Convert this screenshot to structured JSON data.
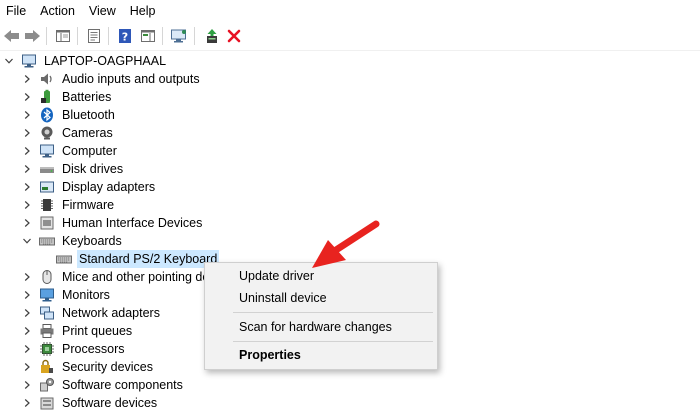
{
  "menu": {
    "file": "File",
    "action": "Action",
    "view": "View",
    "help": "Help"
  },
  "toolbar": {
    "buttons": [
      "back-icon",
      "forward-icon",
      "show-hide-console-tree-icon",
      "properties-icon",
      "help-icon",
      "action-pane-icon",
      "scan-hardware-icon",
      "update-driver-icon",
      "uninstall-icon"
    ]
  },
  "tree": {
    "root": "LAPTOP-OAGPHAAL",
    "categories": [
      {
        "label": "Audio inputs and outputs",
        "icon": "speaker-icon"
      },
      {
        "label": "Batteries",
        "icon": "battery-icon"
      },
      {
        "label": "Bluetooth",
        "icon": "bluetooth-icon"
      },
      {
        "label": "Cameras",
        "icon": "camera-icon"
      },
      {
        "label": "Computer",
        "icon": "computer-icon"
      },
      {
        "label": "Disk drives",
        "icon": "disk-drive-icon"
      },
      {
        "label": "Display adapters",
        "icon": "display-adapter-icon"
      },
      {
        "label": "Firmware",
        "icon": "firmware-icon"
      },
      {
        "label": "Human Interface Devices",
        "icon": "hid-icon"
      },
      {
        "label": "Keyboards",
        "icon": "keyboard-icon"
      },
      {
        "label": "Standard PS/2 Keyboard",
        "icon": "keyboard-icon"
      },
      {
        "label": "Mice and other pointing de",
        "icon": "mouse-icon"
      },
      {
        "label": "Monitors",
        "icon": "monitor-icon"
      },
      {
        "label": "Network adapters",
        "icon": "network-adapter-icon"
      },
      {
        "label": "Print queues",
        "icon": "printer-icon"
      },
      {
        "label": "Processors",
        "icon": "processor-icon"
      },
      {
        "label": "Security devices",
        "icon": "security-device-icon"
      },
      {
        "label": "Software components",
        "icon": "software-component-icon"
      },
      {
        "label": "Software devices",
        "icon": "software-device-icon"
      }
    ]
  },
  "context_menu": {
    "update": "Update driver",
    "uninstall": "Uninstall device",
    "scan": "Scan for hardware changes",
    "properties": "Properties"
  },
  "colors": {
    "selection": "#cce8ff",
    "arrow": "#e8231f",
    "menu_bg": "#f2f2f2",
    "uninstall_x": "#e81123"
  }
}
